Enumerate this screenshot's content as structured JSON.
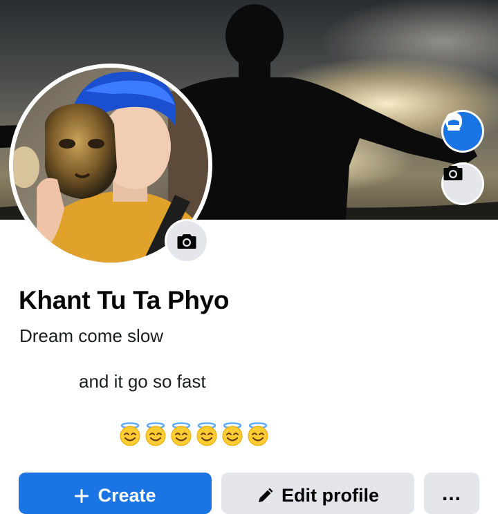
{
  "profile": {
    "name": "Khant Tu Ta Phyo",
    "bio_line_1": "Dream come slow",
    "bio_line_2": "and it go so fast",
    "emoji_count": 6,
    "emoji_icon": "smiling-face-with-halo-icon"
  },
  "buttons": {
    "create_label": "Create",
    "create_icon": "plus-icon",
    "edit_label": "Edit profile",
    "edit_icon": "pencil-icon",
    "more_label": "...",
    "more_icon": "more-dots-icon"
  },
  "cover": {
    "avatar_button_icon": "avatar-icon",
    "camera_icon": "camera-icon"
  },
  "colors": {
    "primary": "#1b74e4",
    "secondary_button": "#e4e6eb",
    "text": "#050505"
  }
}
